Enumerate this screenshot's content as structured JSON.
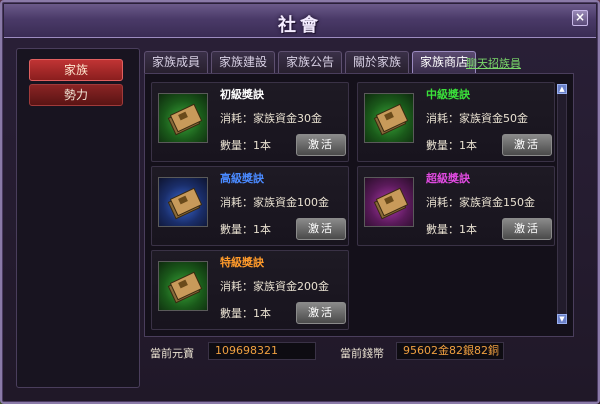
{
  "window": {
    "title": "社會",
    "close_label": "×"
  },
  "sidebar": {
    "items": [
      {
        "label": "家族",
        "active": true
      },
      {
        "label": "勢力",
        "active": false
      }
    ]
  },
  "tabs": [
    {
      "label": "家族成員",
      "active": false
    },
    {
      "label": "家族建設",
      "active": false
    },
    {
      "label": "家族公告",
      "active": false
    },
    {
      "label": "關於家族",
      "active": false
    },
    {
      "label": "家族商店",
      "active": true
    }
  ],
  "recruit_link": "聊天招族員",
  "shop": {
    "items": [
      {
        "name": "初級獎訣",
        "name_color": "#ffffff",
        "cost": "消耗：家族資金30金",
        "qty": "數量：1本",
        "button": "激活",
        "icon": "green-book-icon"
      },
      {
        "name": "中級獎訣",
        "name_color": "#3ae03a",
        "cost": "消耗：家族資金50金",
        "qty": "數量：1本",
        "button": "激活",
        "icon": "green-book-icon"
      },
      {
        "name": "高級獎訣",
        "name_color": "#4a8aff",
        "cost": "消耗：家族資金100金",
        "qty": "數量：1本",
        "button": "激活",
        "icon": "blue-book-icon"
      },
      {
        "name": "超級獎訣",
        "name_color": "#e04ae0",
        "cost": "消耗：家族資金150金",
        "qty": "數量：1本",
        "button": "激活",
        "icon": "purple-book-icon"
      },
      {
        "name": "特級獎訣",
        "name_color": "#ff9a2a",
        "cost": "消耗：家族資金200金",
        "qty": "數量：1本",
        "button": "激活",
        "icon": "green-book-icon"
      }
    ]
  },
  "footer": {
    "yuanbao_label": "當前元寶",
    "yuanbao_value": "109698321",
    "money_label": "當前錢幣",
    "money_value": "95602金82銀82銅"
  }
}
